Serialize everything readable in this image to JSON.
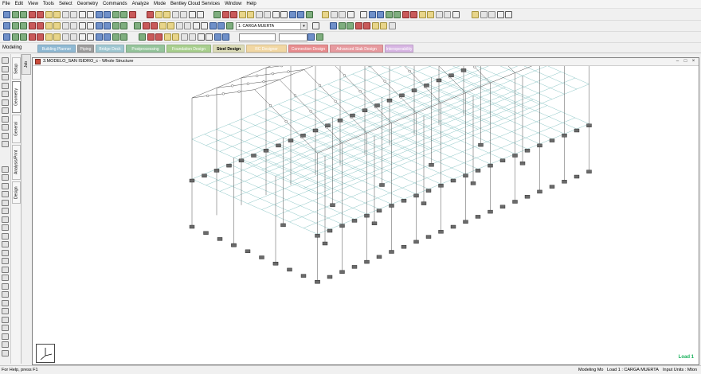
{
  "menu": [
    "File",
    "Edit",
    "View",
    "Tools",
    "Select",
    "Geometry",
    "Commands",
    "Analyze",
    "Mode",
    "Bentley Cloud Services",
    "Window",
    "Help"
  ],
  "toolbar": {
    "load_combo_value": "1: CARGA MUERTA",
    "empty_combo_value": ""
  },
  "workspace": {
    "label": "Modeling",
    "tabs": [
      {
        "label": "Building Planner",
        "color": "#8fb9d3"
      },
      {
        "label": "Piping",
        "color": "#9e9e9e"
      },
      {
        "label": "Bridge Deck",
        "color": "#9fc7d1"
      },
      {
        "label": "Postprocessing",
        "color": "#95c49b"
      },
      {
        "label": "Foundation Design",
        "color": "#a8cf8e"
      },
      {
        "label": "Steel Design",
        "color": "#dcdcb8"
      },
      {
        "label": "RC Designer",
        "color": "#f1d7a3"
      },
      {
        "label": "Connection Design",
        "color": "#e88d8f"
      },
      {
        "label": "Advanced Slab Design",
        "color": "#e79a9f"
      },
      {
        "label": "Interoperability",
        "color": "#d7b5e3"
      }
    ]
  },
  "side_panel": {
    "tabs": [
      "Setup",
      "Geometry",
      "General",
      "Analysis/Print",
      "Design"
    ],
    "job_tab": "Job"
  },
  "window": {
    "title": "3.MODELO_SAN ISIDRO_c - Whole Structure"
  },
  "viewport": {
    "load_label": "Load 1"
  },
  "status": {
    "help": "For Help, press F1",
    "mode": "Modeling Mo",
    "load": "Load 1 : CARGA MUERTA",
    "units": "Input Units : Mton"
  }
}
